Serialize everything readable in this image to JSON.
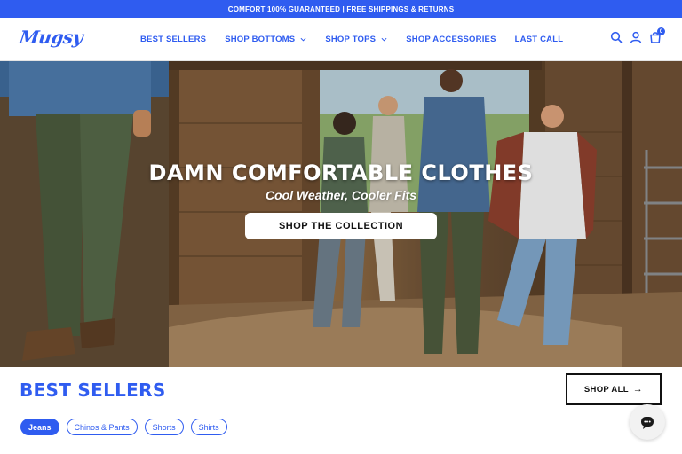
{
  "announcement": "COMFORT 100% GUARANTEED | FREE SHIPPINGS & RETURNS",
  "brand": {
    "logo_text": "Mugsy",
    "accent_color": "#2f5cf0"
  },
  "nav": {
    "items": [
      {
        "label": "BEST SELLERS",
        "dropdown": false
      },
      {
        "label": "SHOP BOTTOMS",
        "dropdown": true
      },
      {
        "label": "SHOP TOPS",
        "dropdown": true
      },
      {
        "label": "SHOP ACCESSORIES",
        "dropdown": false
      },
      {
        "label": "LAST CALL",
        "dropdown": false
      }
    ]
  },
  "header_icons": [
    "search-icon",
    "account-icon",
    "cart-icon"
  ],
  "cart": {
    "count": "0"
  },
  "hero": {
    "title": "DAMN COMFORTABLE CLOTHES",
    "subtitle": "Cool Weather, Cooler Fits",
    "cta": "SHOP THE COLLECTION"
  },
  "best_sellers": {
    "title": "BEST SELLERS",
    "shop_all": "SHOP ALL",
    "filters": [
      {
        "label": "Jeans",
        "active": true
      },
      {
        "label": "Chinos & Pants",
        "active": false
      },
      {
        "label": "Shorts",
        "active": false
      },
      {
        "label": "Shirts",
        "active": false
      }
    ]
  },
  "chat": {
    "icon": "chat-icon"
  }
}
